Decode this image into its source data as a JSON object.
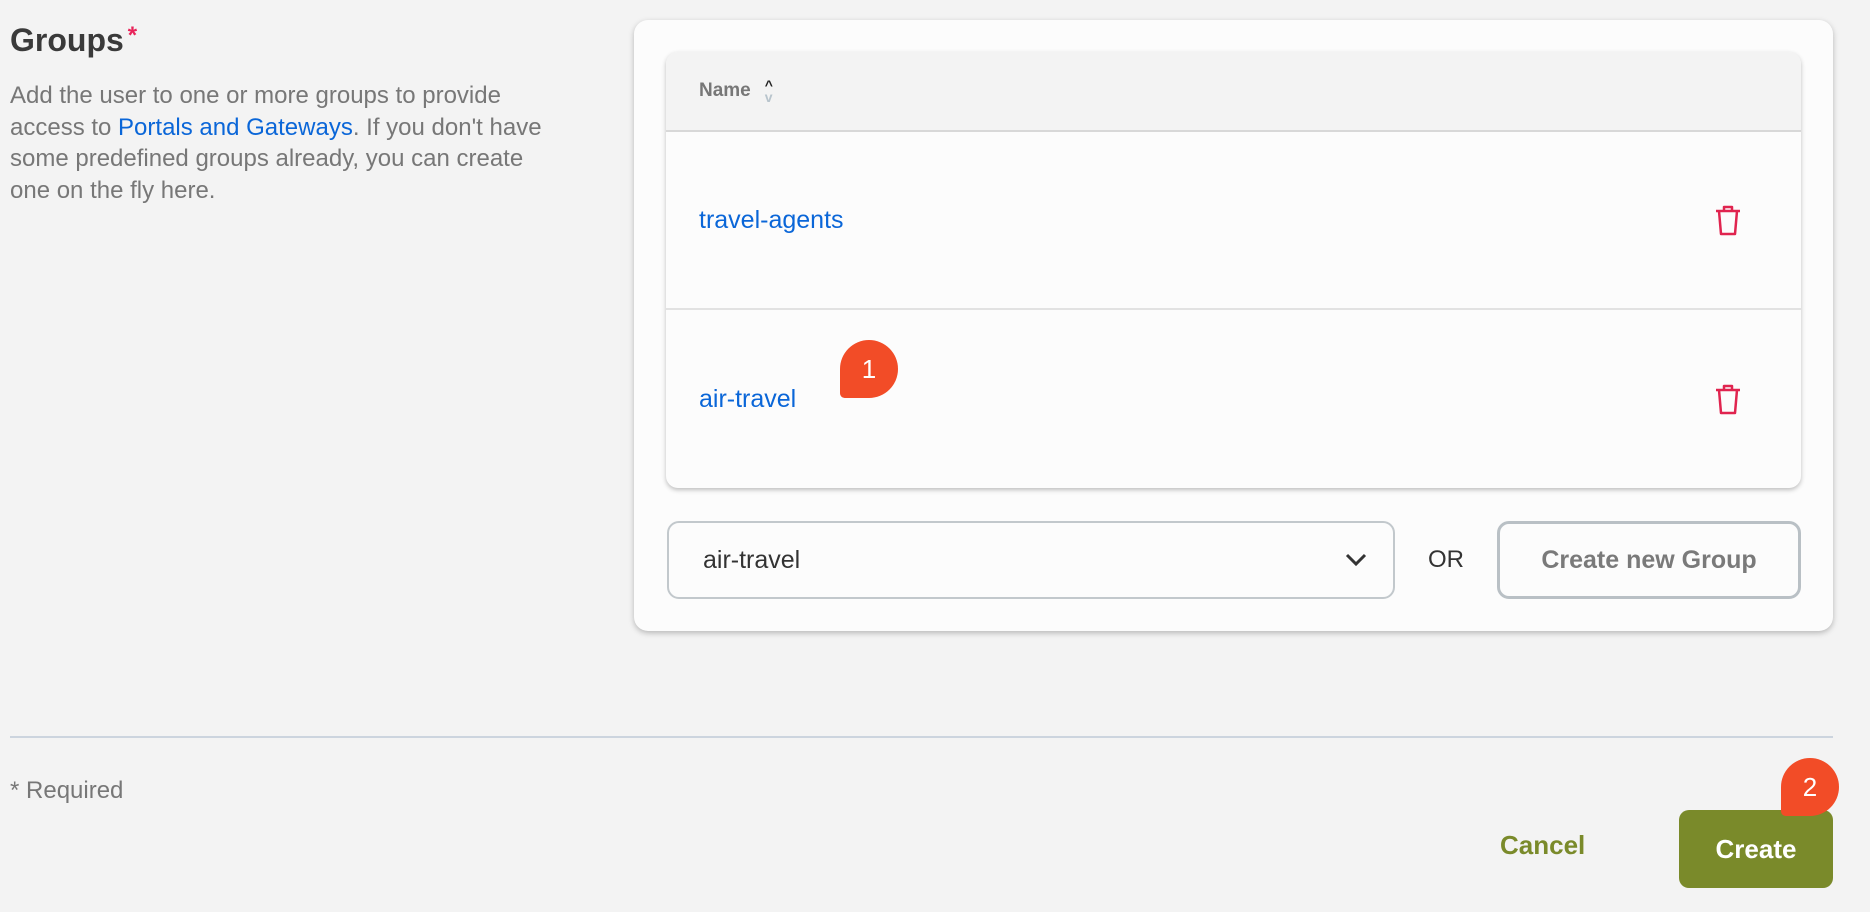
{
  "section": {
    "title": "Groups",
    "required_marker": "*",
    "description_before": "Add the user to one or more groups to provide access to ",
    "description_link": "Portals and Gateways",
    "description_after": ". If you don't have some predefined groups already, you can create one on the fly here."
  },
  "table": {
    "column_name": "Name",
    "rows": [
      {
        "name": "travel-agents"
      },
      {
        "name": "air-travel"
      }
    ]
  },
  "group_select": {
    "value": "air-travel"
  },
  "or_label": "OR",
  "create_group_label": "Create new Group",
  "required_note": "* Required",
  "footer": {
    "cancel_label": "Cancel",
    "create_label": "Create"
  },
  "badges": [
    "1",
    "2"
  ],
  "colors": {
    "accent": "#7a8a2a",
    "link": "#0a66d8",
    "danger": "#e0244f",
    "badge": "#f24c27"
  }
}
